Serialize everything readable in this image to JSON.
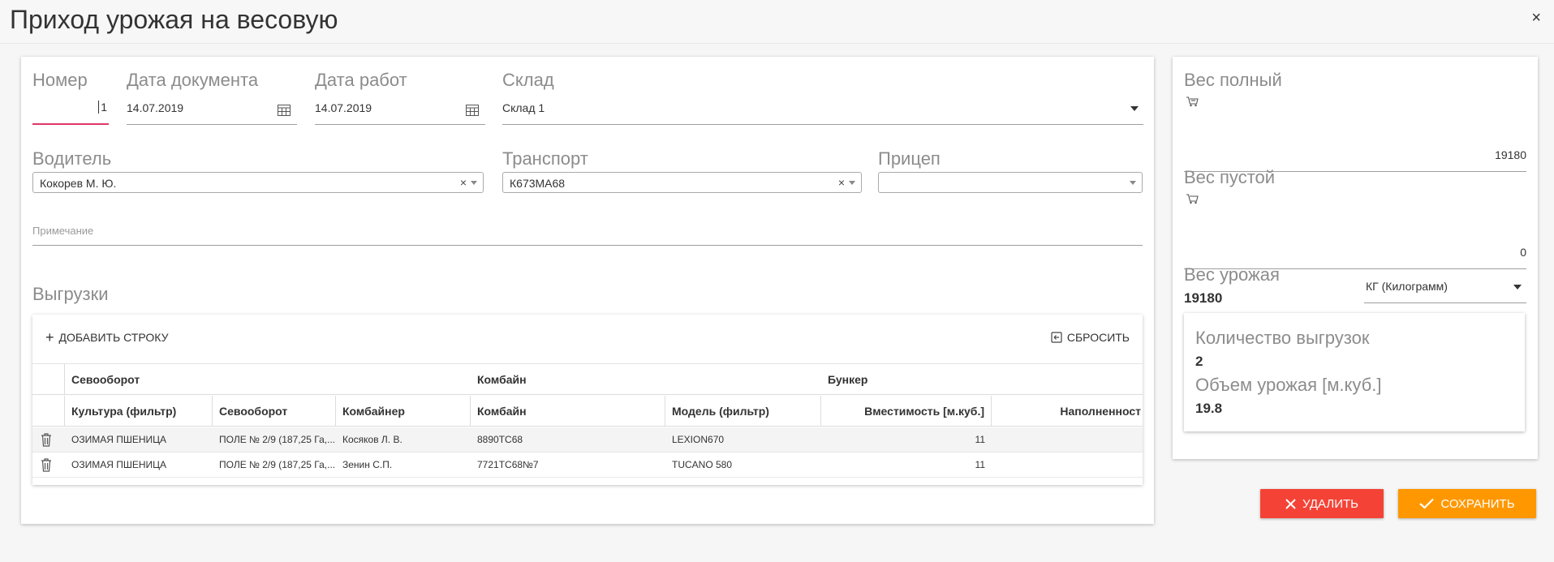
{
  "window": {
    "title": "Приход урожая на весовую",
    "close_glyph": "×"
  },
  "form": {
    "number": {
      "label": "Номер",
      "value": "1"
    },
    "doc_date": {
      "label": "Дата документа",
      "value": "14.07.2019"
    },
    "work_date": {
      "label": "Дата работ",
      "value": "14.07.2019"
    },
    "warehouse": {
      "label": "Склад",
      "value": "Склад 1"
    },
    "driver": {
      "label": "Водитель",
      "value": "Кокорев М. Ю."
    },
    "transport": {
      "label": "Транспорт",
      "value": "К673МА68"
    },
    "trailer": {
      "label": "Прицеп",
      "value": ""
    },
    "note": {
      "placeholder": "Примечание"
    }
  },
  "unloads": {
    "title": "Выгрузки",
    "add_row_label": "ДОБАВИТЬ СТРОКУ",
    "reset_label": "СБРОСИТЬ",
    "group_headers": [
      "Севооборот",
      "Комбайн",
      "Бункер"
    ],
    "columns": [
      "Культура (фильтр)",
      "Севооборот",
      "Комбайнер",
      "Комбайн",
      "Модель (фильтр)",
      "Вместимость [м.куб.]",
      "Наполненност"
    ],
    "rows": [
      {
        "crop": "ОЗИМАЯ ПШЕНИЦА",
        "rotation": "ПОЛЕ № 2/9 (187,25 Га,...",
        "operator": "Косяков Л. В.",
        "combine": "8890ТС68",
        "model": "LEXION670",
        "capacity": "11",
        "fill": ""
      },
      {
        "crop": "ОЗИМАЯ ПШЕНИЦА",
        "rotation": "ПОЛЕ № 2/9 (187,25 Га,...",
        "operator": "Зенин С.П.",
        "combine": "7721ТС68№7",
        "model": "TUCANO 580",
        "capacity": "11",
        "fill": ""
      }
    ]
  },
  "weights": {
    "full": {
      "label": "Вес полный",
      "value": "19180"
    },
    "empty": {
      "label": "Вес пустой",
      "value": "0"
    },
    "harvest": {
      "label": "Вес урожая",
      "value": "19180"
    },
    "unit": {
      "value": "КГ (Килограмм)"
    }
  },
  "stats": {
    "unload_count_label": "Количество выгрузок",
    "unload_count": "2",
    "volume_label": "Объем урожая [м.куб.]",
    "volume": "19.8"
  },
  "actions": {
    "delete_label": "УДАЛИТЬ",
    "save_label": "СОХРАНИТЬ"
  },
  "colors": {
    "delete": "#f44336",
    "save": "#ff9800",
    "focus_underline": "#e0356b"
  }
}
